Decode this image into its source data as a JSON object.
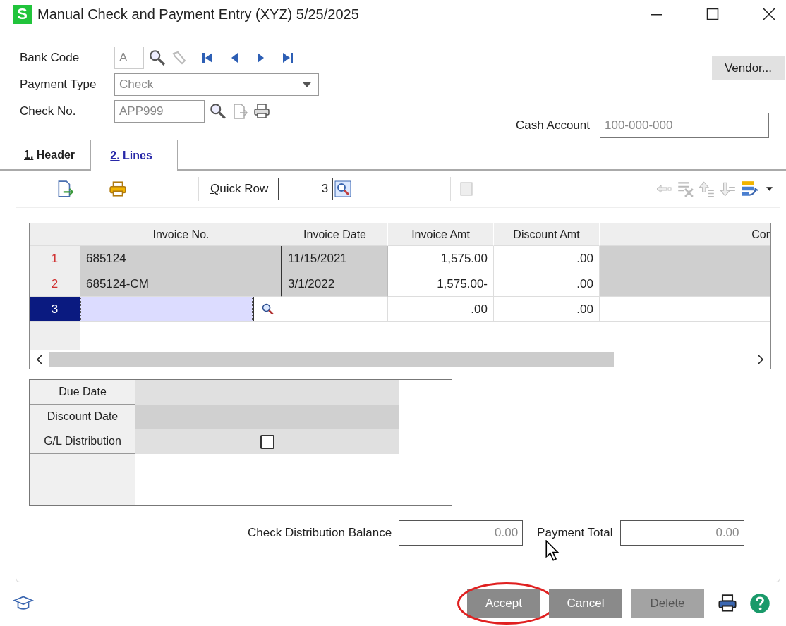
{
  "window": {
    "title": "Manual Check and Payment Entry (XYZ) 5/25/2025",
    "app_icon": "S"
  },
  "header": {
    "bank_code": {
      "label": "Bank Code",
      "value": "A"
    },
    "payment_type": {
      "label": "Payment Type",
      "value": "Check"
    },
    "check_no": {
      "label": "Check No.",
      "value": "APP999"
    },
    "vendor_button": "Vendor...",
    "cash_account": {
      "label": "Cash Account",
      "value": "100-000-000"
    }
  },
  "tabs": [
    {
      "label": "1. Header",
      "selected": false
    },
    {
      "label": "2. Lines",
      "selected": true
    }
  ],
  "toolbar": {
    "quick_row": {
      "label": "Quick Row",
      "value": "3"
    }
  },
  "grid": {
    "columns": [
      "Invoice No.",
      "Invoice Date",
      "Invoice Amt",
      "Discount Amt",
      "Cor"
    ],
    "rows": [
      {
        "number": "1",
        "selected": false,
        "invoice_no": "685124",
        "invoice_date": "11/15/2021",
        "invoice_amt": "1,575.00",
        "discount_amt": ".00"
      },
      {
        "number": "2",
        "selected": false,
        "invoice_no": "685124-CM",
        "invoice_date": "3/1/2022",
        "invoice_amt": "1,575.00-",
        "discount_amt": ".00"
      },
      {
        "number": "3",
        "selected": true,
        "invoice_amt": ".00",
        "discount_amt": ".00"
      }
    ]
  },
  "details": [
    {
      "label": "Due Date",
      "kind": "text"
    },
    {
      "label": "Discount Date",
      "kind": "text"
    },
    {
      "label": "G/L Distribution",
      "kind": "checkbox",
      "checked": false
    }
  ],
  "totals": {
    "check_distribution_balance": {
      "label": "Check Distribution Balance",
      "value": "0.00"
    },
    "payment_total": {
      "label": "Payment Total",
      "value": "0.00"
    }
  },
  "buttons": [
    {
      "label": "Accept",
      "disabled": false,
      "circled": true
    },
    {
      "label": "Cancel",
      "disabled": false,
      "circled": false
    },
    {
      "label": "Delete",
      "disabled": true,
      "circled": false
    }
  ]
}
